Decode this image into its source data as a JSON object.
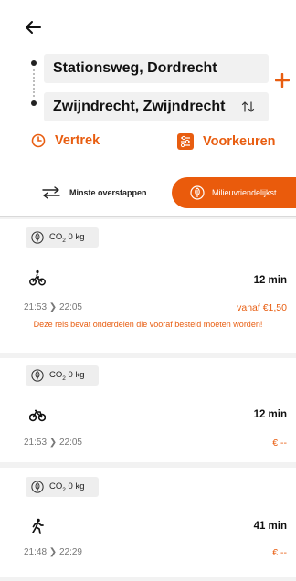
{
  "header": {
    "back_icon": "arrow-left-icon",
    "from": "Stationsweg, Dordrecht",
    "to": "Zwijndrecht, Zwijndrecht",
    "swap_icon": "swap-vertical-icon",
    "add_icon": "plus-icon"
  },
  "options": {
    "vertrek_label": "Vertrek",
    "voorkeuren_label": "Voorkeuren"
  },
  "sort": {
    "left_label": "Minste overstappen",
    "right_label": "Milieuvriendelijkst"
  },
  "colors": {
    "accent": "#e85d10",
    "accent_strong": "#ea5b0c",
    "field_bg": "#f1f1f1",
    "list_bg": "#f2f2f2"
  },
  "results": [
    {
      "co2_prefix": "CO",
      "co2_sub": "2",
      "co2_value": "0 kg",
      "mode_icon": "bicycle-person-icon",
      "duration": "12 min",
      "time_range": "21:53 ❯ 22:05",
      "price": "vanaf €1,50",
      "warning": "Deze reis bevat onderdelen die vooraf besteld moeten worden!"
    },
    {
      "co2_prefix": "CO",
      "co2_sub": "2",
      "co2_value": "0 kg",
      "mode_icon": "bicycle-icon",
      "duration": "12 min",
      "time_range": "21:53 ❯ 22:05",
      "price": "€ --"
    },
    {
      "co2_prefix": "CO",
      "co2_sub": "2",
      "co2_value": "0 kg",
      "mode_icon": "walking-icon",
      "duration": "41 min",
      "time_range": "21:48 ❯ 22:29",
      "price": "€ --"
    }
  ]
}
